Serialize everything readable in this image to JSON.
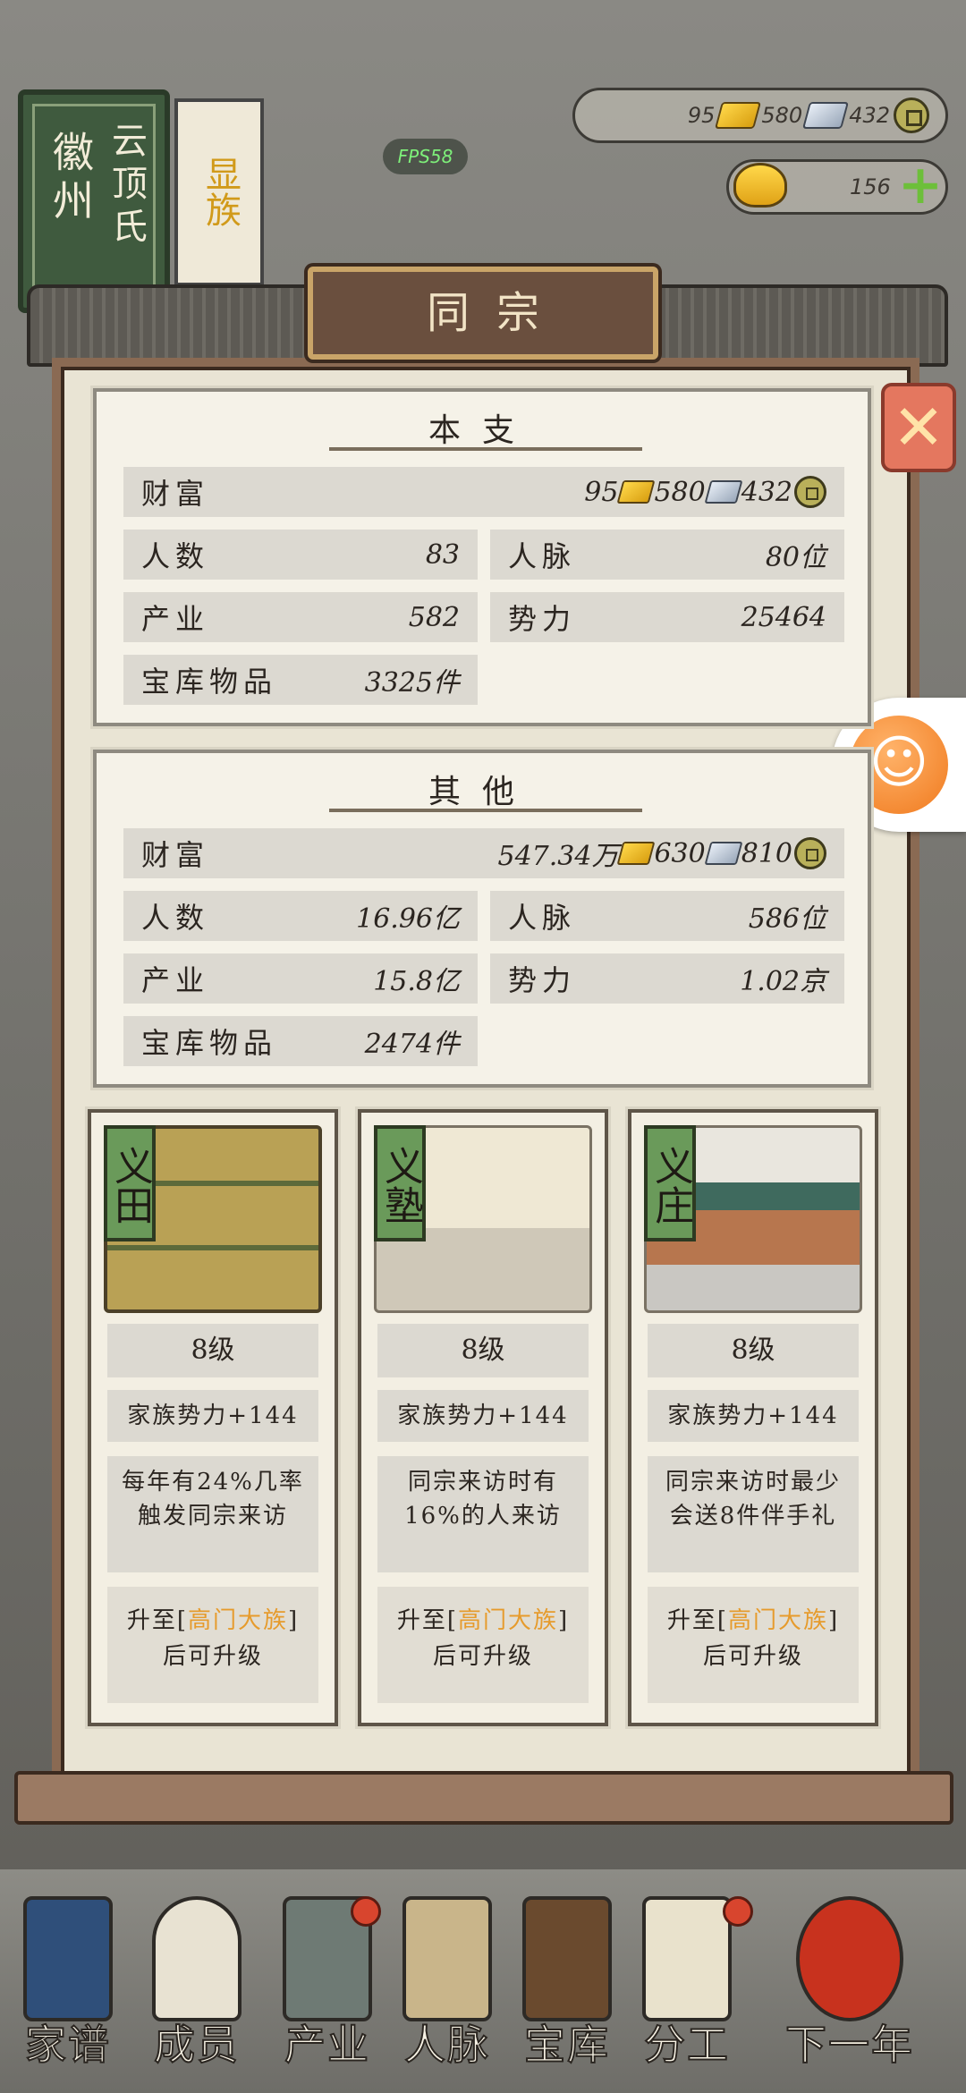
{
  "header": {
    "fps": "FPS58",
    "book_title_main": "徽州",
    "book_title_sub": "云顶氏",
    "clan_rank": "显族",
    "resources": {
      "gold": "95",
      "silver": "580",
      "coin": "432"
    },
    "yuanbao": "156"
  },
  "dialog": {
    "title": "同宗",
    "close_icon": "close-icon"
  },
  "own_branch": {
    "title": "本支",
    "wealth_label": "财富",
    "wealth_gold": "95",
    "wealth_silver": "580",
    "wealth_coin": "432",
    "people_label": "人数",
    "people_value": "83",
    "network_label": "人脉",
    "network_value": "80位",
    "industry_label": "产业",
    "industry_value": "582",
    "power_label": "势力",
    "power_value": "25464",
    "treasury_label": "宝库物品",
    "treasury_value": "3325件"
  },
  "others": {
    "title": "其他",
    "wealth_label": "财富",
    "wealth_gold": "547.34万",
    "wealth_silver": "630",
    "wealth_coin": "810",
    "people_label": "人数",
    "people_value": "16.96亿",
    "network_label": "人脉",
    "network_value": "586位",
    "industry_label": "产业",
    "industry_value": "15.8亿",
    "power_label": "势力",
    "power_value": "1.02京",
    "treasury_label": "宝库物品",
    "treasury_value": "2474件"
  },
  "buildings": [
    {
      "tag": "义田",
      "level": "8级",
      "power": "家族势力+144",
      "desc": "每年有24%几率触发同宗来访",
      "upgrade_prefix": "升至[",
      "upgrade_highlight": "高门大族",
      "upgrade_suffix": "]后可升级"
    },
    {
      "tag": "义塾",
      "level": "8级",
      "power": "家族势力+144",
      "desc": "同宗来访时有16%的人来访",
      "upgrade_prefix": "升至[",
      "upgrade_highlight": "高门大族",
      "upgrade_suffix": "]后可升级"
    },
    {
      "tag": "义庄",
      "level": "8级",
      "power": "家族势力+144",
      "desc": "同宗来访时最少会送8件伴手礼",
      "upgrade_prefix": "升至[",
      "upgrade_highlight": "高门大族",
      "upgrade_suffix": "]后可升级"
    }
  ],
  "nav": [
    {
      "label": "家谱",
      "icon": "genealogy-book-icon"
    },
    {
      "label": "成员",
      "icon": "member-portrait-icon"
    },
    {
      "label": "产业",
      "icon": "industry-building-icon"
    },
    {
      "label": "人脉",
      "icon": "network-graph-icon"
    },
    {
      "label": "宝库",
      "icon": "treasure-chest-icon"
    },
    {
      "label": "分工",
      "icon": "scroll-icon"
    },
    {
      "label": "下一年",
      "icon": "lantern-icon"
    }
  ],
  "colors": {
    "highlight": "#e69b2c",
    "panel_border": "#8a6a53",
    "tag_green": "#6a9a5a"
  }
}
